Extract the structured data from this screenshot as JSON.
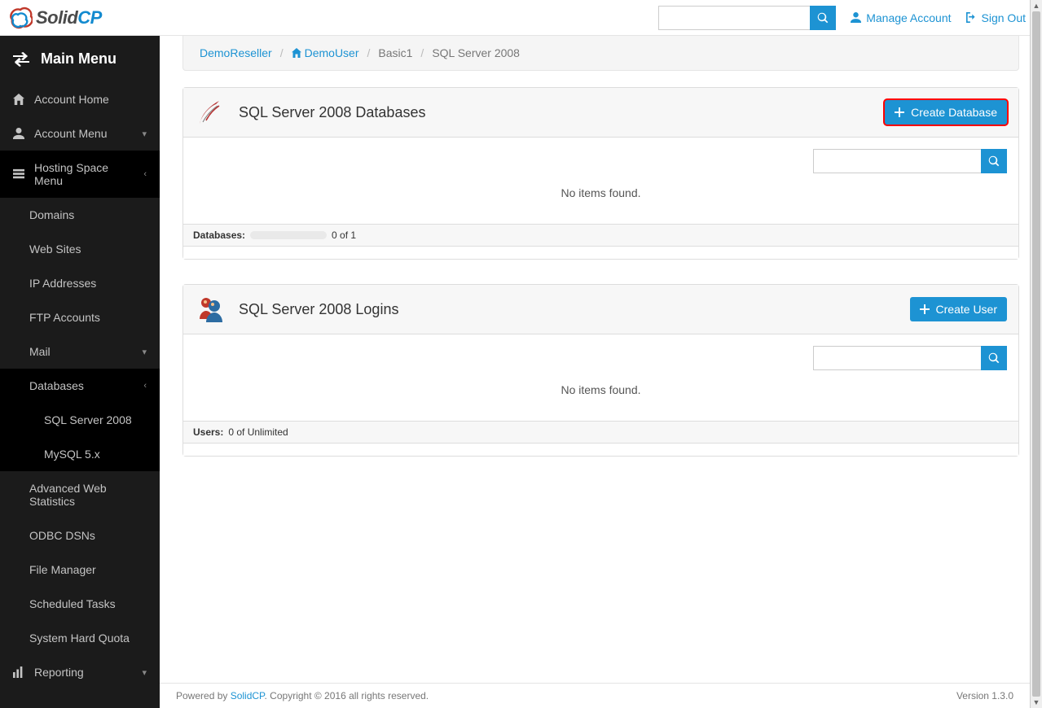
{
  "topbar": {
    "search_placeholder": "",
    "manage": "Manage Account",
    "signout": "Sign Out"
  },
  "sidebar": {
    "header": "Main Menu",
    "account_home": "Account Home",
    "account_menu": "Account Menu",
    "hosting_space": "Hosting Space Menu",
    "items": {
      "domains": "Domains",
      "websites": "Web Sites",
      "ip": "IP Addresses",
      "ftp": "FTP Accounts",
      "mail": "Mail",
      "databases": "Databases",
      "sql2008": "SQL Server 2008",
      "mysql": "MySQL 5.x",
      "aws": "Advanced Web Statistics",
      "odbc": "ODBC DSNs",
      "fm": "File Manager",
      "tasks": "Scheduled Tasks",
      "quota": "System Hard Quota"
    },
    "reporting": "Reporting"
  },
  "breadcrumb": {
    "a": "DemoReseller",
    "b": "DemoUser",
    "c": "Basic1",
    "d": "SQL Server 2008"
  },
  "panel1": {
    "title": "SQL Server 2008 Databases",
    "button": "Create Database",
    "msg": "No items found.",
    "footer_label": "Databases:",
    "footer_value": "0 of 1"
  },
  "panel2": {
    "title": "SQL Server 2008 Logins",
    "button": "Create User",
    "msg": "No items found.",
    "footer_label": "Users:",
    "footer_value": "0 of Unlimited"
  },
  "footer": {
    "powered": "Powered by ",
    "brand": "SolidCP",
    "rest": ". Copyright © 2016 all rights reserved.",
    "version": "Version 1.3.0"
  }
}
